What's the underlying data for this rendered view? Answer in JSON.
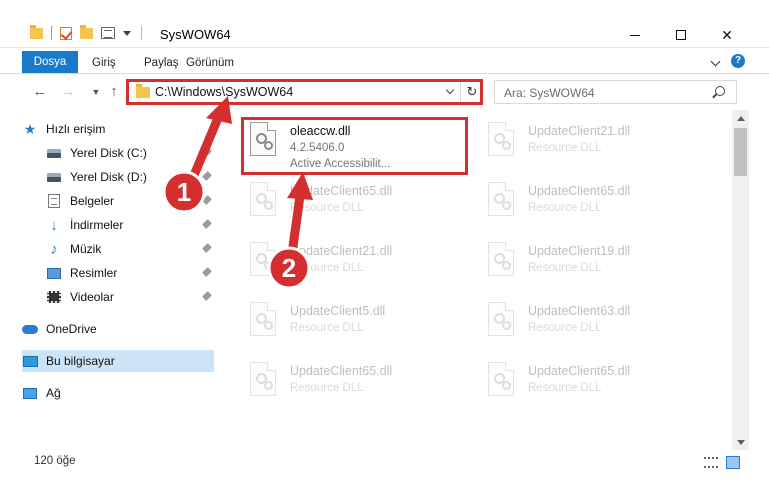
{
  "window": {
    "title": "SysWOW64",
    "controls": {
      "minimize": "minimize",
      "maximize": "maximize",
      "close": "close"
    }
  },
  "ribbon": {
    "tabs": [
      {
        "label": "Dosya",
        "active": true
      },
      {
        "label": "Giriş"
      },
      {
        "label": "Paylaş"
      },
      {
        "label": "Görünüm"
      }
    ],
    "help": "?"
  },
  "navigation": {
    "address": "C:\\Windows\\SysWOW64",
    "search_placeholder": "Ara: SysWOW64"
  },
  "sidebar": {
    "items": [
      {
        "label": "Hızlı erişim",
        "icon": "star-icon"
      },
      {
        "label": "Yerel Disk (C:)",
        "icon": "disk-icon",
        "pinned": true
      },
      {
        "label": "Yerel Disk (D:)",
        "icon": "disk-icon",
        "pinned": true
      },
      {
        "label": "Belgeler",
        "icon": "documents-icon",
        "pinned": true
      },
      {
        "label": "İndirmeler",
        "icon": "download-icon",
        "pinned": true
      },
      {
        "label": "Müzik",
        "icon": "music-icon",
        "pinned": true
      },
      {
        "label": "Resimler",
        "icon": "pictures-icon",
        "pinned": true
      },
      {
        "label": "Videolar",
        "icon": "videos-icon",
        "pinned": true
      },
      {
        "label": "OneDrive",
        "icon": "onedrive-icon"
      },
      {
        "label": "Bu bilgisayar",
        "icon": "this-pc-icon",
        "selected": true
      },
      {
        "label": "Ağ",
        "icon": "network-icon"
      }
    ]
  },
  "files": [
    {
      "name": "oleaccw.dll",
      "version": "4.2.5406.0",
      "description": "Active Accessibilit..."
    },
    {
      "name": "UpdateClient21.dll",
      "description": "Resource DLL"
    },
    {
      "name": "UpdateClient65.dll",
      "description": "Resource DLL"
    },
    {
      "name": "UpdateClient65.dll",
      "description": "Resource DLL"
    },
    {
      "name": "UpdateClient21.dll",
      "description": "Resource DLL"
    },
    {
      "name": "UpdateClient19.dll",
      "description": "Resource DLL"
    },
    {
      "name": "UpdateClient5.dll",
      "description": "Resource DLL"
    },
    {
      "name": "UpdateClient63.dll",
      "description": "Resource DLL"
    },
    {
      "name": "UpdateClient65.dll",
      "description": "Resource DLL"
    },
    {
      "name": "UpdateClient65.dll",
      "description": "Resource DLL"
    }
  ],
  "status": {
    "item_count": "120 öğe"
  },
  "annotations": [
    {
      "label": "1"
    },
    {
      "label": "2"
    }
  ],
  "colors": {
    "accent": "#1979ca",
    "highlight": "#d32f2f",
    "selected": "#cce4f7"
  }
}
